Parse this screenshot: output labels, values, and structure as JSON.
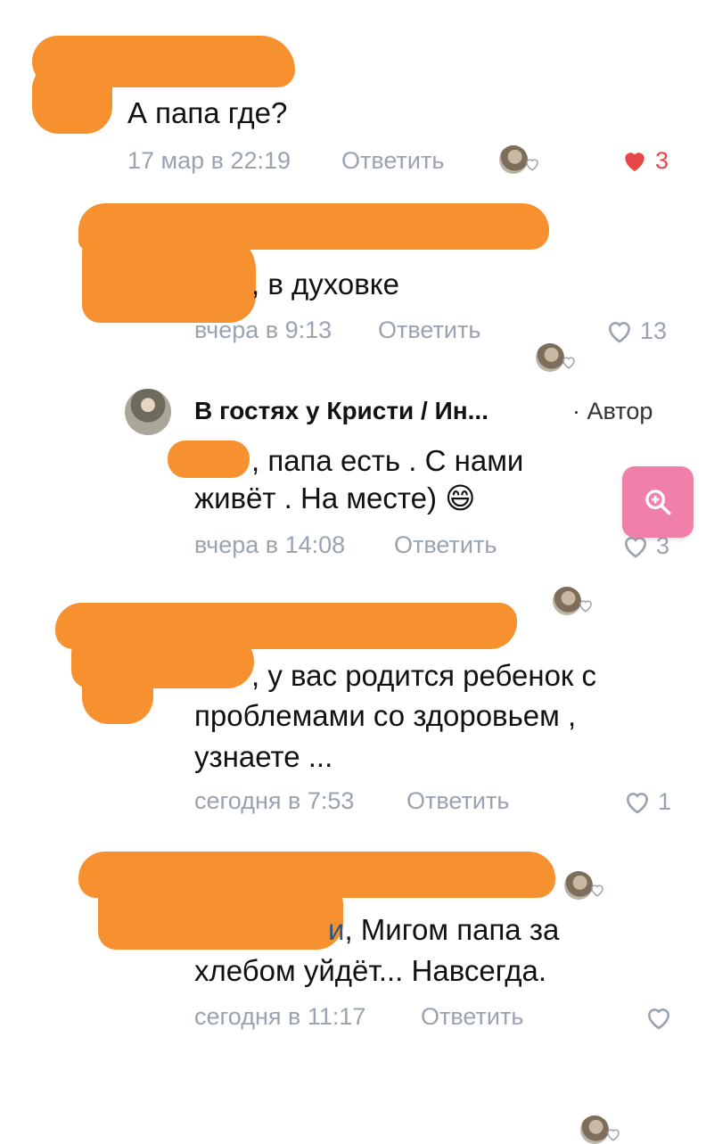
{
  "comments": [
    {
      "text": "А папа где?",
      "time": "17 мар в 22:19",
      "reply_label": "Ответить",
      "likes": "3",
      "liked": true
    },
    {
      "text": ", в духовке",
      "time": "вчера в 9:13",
      "reply_label": "Ответить",
      "likes": "13",
      "liked": false
    },
    {
      "author": "В гостях у Кристи / Ин...",
      "author_tag": "· Автор",
      "text_line1": ", папа есть . С нами",
      "text_line2": "живёт . На месте)",
      "emoji": "😄",
      "time": "вчера в 14:08",
      "reply_label": "Ответить",
      "likes": "3",
      "liked": false
    },
    {
      "text_line1": ", у вас родится ребенок с",
      "text_line2": "проблемами со здоровьем ,",
      "text_line3": "узнаете ...",
      "time": "сегодня в 7:53",
      "reply_label": "Ответить",
      "likes": "1",
      "liked": false
    },
    {
      "link_fragment": "и",
      "text_line1": ", Мигом папа за",
      "text_line2": "хлебом уйдёт... Навсегда.",
      "time": "сегодня в 11:17",
      "reply_label": "Ответить",
      "likes": "",
      "liked": false
    }
  ],
  "colors": {
    "redaction": "#f7902e",
    "meta": "#9aa3b0",
    "like_active": "#e64646",
    "zoom_button": "#f07fa9",
    "link": "#2a5885"
  },
  "icons": {
    "like": "heart-icon",
    "zoom": "zoom-in-icon",
    "reactions": "reaction-avatar-icon"
  }
}
